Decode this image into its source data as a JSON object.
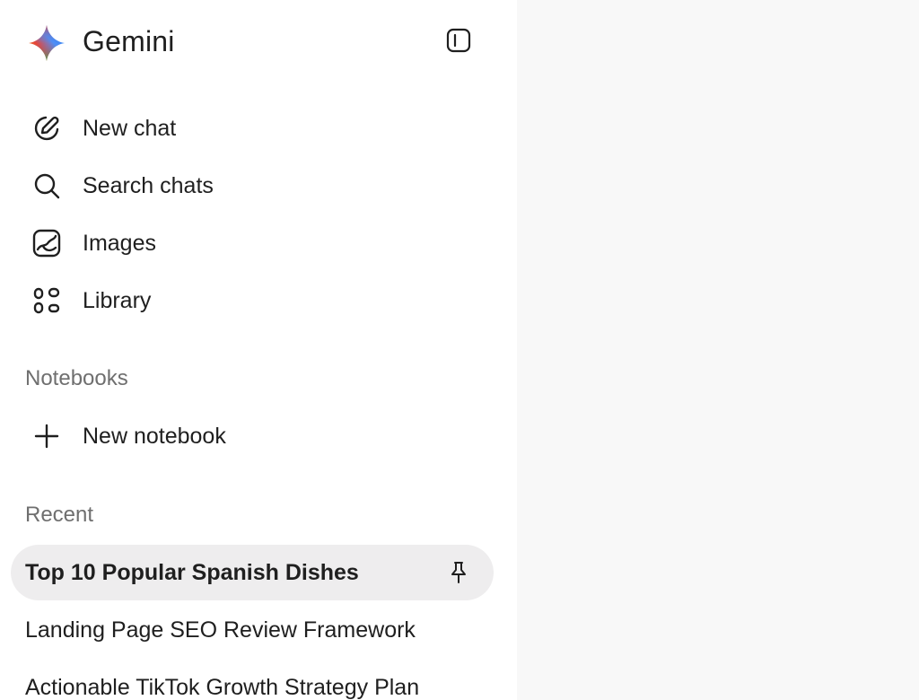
{
  "header": {
    "brand": "Gemini",
    "logo_icon": "gemini-spark-icon",
    "collapse_icon": "sidebar-toggle-icon"
  },
  "nav": {
    "items": [
      {
        "label": "New chat",
        "icon": "edit-pencil-icon"
      },
      {
        "label": "Search chats",
        "icon": "search-icon"
      },
      {
        "label": "Images",
        "icon": "image-icon"
      },
      {
        "label": "Library",
        "icon": "library-grid-icon"
      }
    ]
  },
  "notebooks": {
    "title": "Notebooks",
    "new_label": "New notebook",
    "new_icon": "plus-icon"
  },
  "recent": {
    "title": "Recent",
    "items": [
      {
        "label": "Top 10 Popular Spanish Dishes",
        "pinned": true
      },
      {
        "label": "Landing Page SEO Review Framework",
        "pinned": false
      },
      {
        "label": "Actionable TikTok Growth Strategy Plan",
        "pinned": false
      }
    ]
  },
  "colors": {
    "sidebar_bg": "#ffffff",
    "main_bg": "#f8f8f8",
    "active_item_bg": "#eeedee",
    "section_title": "#6f6f6f",
    "text": "#1f1f1f"
  }
}
